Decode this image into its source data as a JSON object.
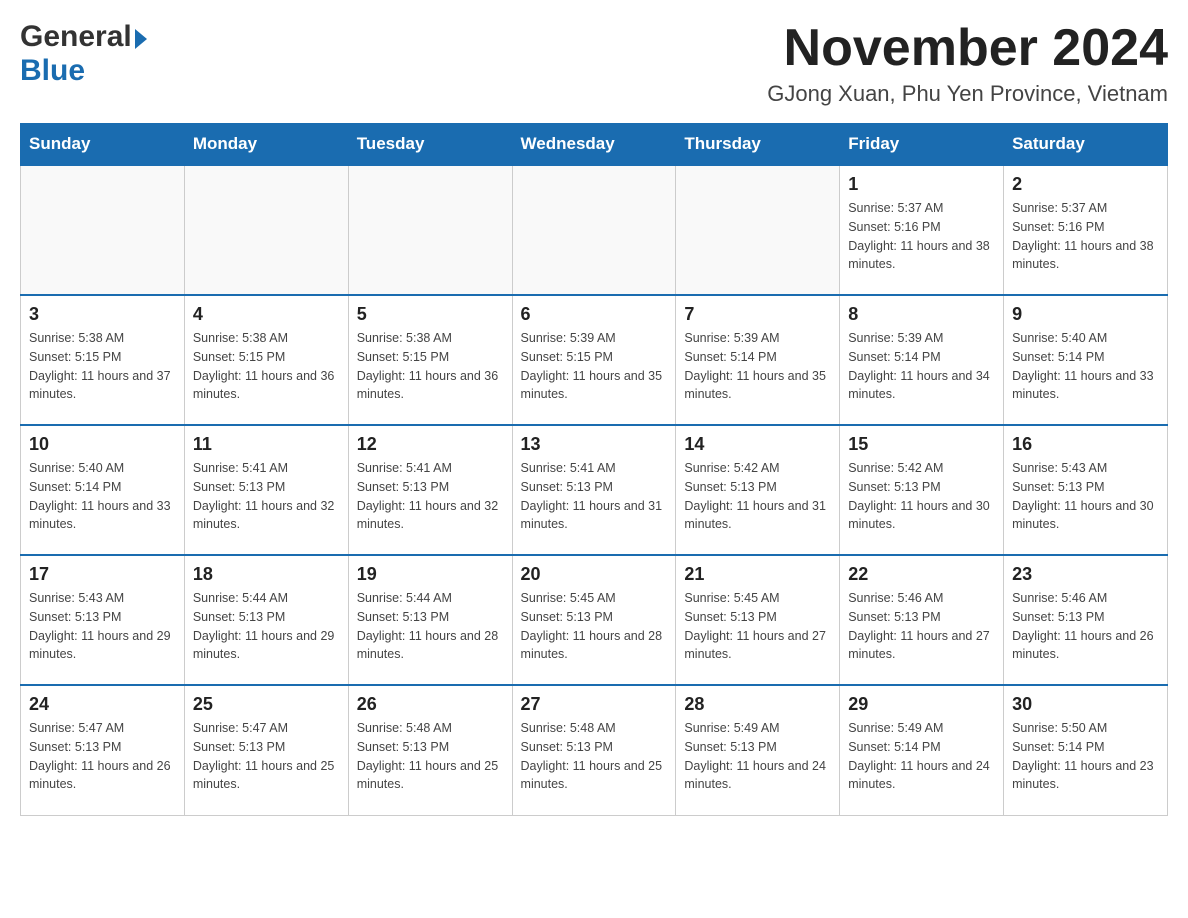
{
  "header": {
    "logo_general": "General",
    "logo_blue": "Blue",
    "month_title": "November 2024",
    "location": "GJong Xuan, Phu Yen Province, Vietnam"
  },
  "days_of_week": [
    "Sunday",
    "Monday",
    "Tuesday",
    "Wednesday",
    "Thursday",
    "Friday",
    "Saturday"
  ],
  "weeks": [
    [
      {
        "day": "",
        "info": ""
      },
      {
        "day": "",
        "info": ""
      },
      {
        "day": "",
        "info": ""
      },
      {
        "day": "",
        "info": ""
      },
      {
        "day": "",
        "info": ""
      },
      {
        "day": "1",
        "info": "Sunrise: 5:37 AM\nSunset: 5:16 PM\nDaylight: 11 hours and 38 minutes."
      },
      {
        "day": "2",
        "info": "Sunrise: 5:37 AM\nSunset: 5:16 PM\nDaylight: 11 hours and 38 minutes."
      }
    ],
    [
      {
        "day": "3",
        "info": "Sunrise: 5:38 AM\nSunset: 5:15 PM\nDaylight: 11 hours and 37 minutes."
      },
      {
        "day": "4",
        "info": "Sunrise: 5:38 AM\nSunset: 5:15 PM\nDaylight: 11 hours and 36 minutes."
      },
      {
        "day": "5",
        "info": "Sunrise: 5:38 AM\nSunset: 5:15 PM\nDaylight: 11 hours and 36 minutes."
      },
      {
        "day": "6",
        "info": "Sunrise: 5:39 AM\nSunset: 5:15 PM\nDaylight: 11 hours and 35 minutes."
      },
      {
        "day": "7",
        "info": "Sunrise: 5:39 AM\nSunset: 5:14 PM\nDaylight: 11 hours and 35 minutes."
      },
      {
        "day": "8",
        "info": "Sunrise: 5:39 AM\nSunset: 5:14 PM\nDaylight: 11 hours and 34 minutes."
      },
      {
        "day": "9",
        "info": "Sunrise: 5:40 AM\nSunset: 5:14 PM\nDaylight: 11 hours and 33 minutes."
      }
    ],
    [
      {
        "day": "10",
        "info": "Sunrise: 5:40 AM\nSunset: 5:14 PM\nDaylight: 11 hours and 33 minutes."
      },
      {
        "day": "11",
        "info": "Sunrise: 5:41 AM\nSunset: 5:13 PM\nDaylight: 11 hours and 32 minutes."
      },
      {
        "day": "12",
        "info": "Sunrise: 5:41 AM\nSunset: 5:13 PM\nDaylight: 11 hours and 32 minutes."
      },
      {
        "day": "13",
        "info": "Sunrise: 5:41 AM\nSunset: 5:13 PM\nDaylight: 11 hours and 31 minutes."
      },
      {
        "day": "14",
        "info": "Sunrise: 5:42 AM\nSunset: 5:13 PM\nDaylight: 11 hours and 31 minutes."
      },
      {
        "day": "15",
        "info": "Sunrise: 5:42 AM\nSunset: 5:13 PM\nDaylight: 11 hours and 30 minutes."
      },
      {
        "day": "16",
        "info": "Sunrise: 5:43 AM\nSunset: 5:13 PM\nDaylight: 11 hours and 30 minutes."
      }
    ],
    [
      {
        "day": "17",
        "info": "Sunrise: 5:43 AM\nSunset: 5:13 PM\nDaylight: 11 hours and 29 minutes."
      },
      {
        "day": "18",
        "info": "Sunrise: 5:44 AM\nSunset: 5:13 PM\nDaylight: 11 hours and 29 minutes."
      },
      {
        "day": "19",
        "info": "Sunrise: 5:44 AM\nSunset: 5:13 PM\nDaylight: 11 hours and 28 minutes."
      },
      {
        "day": "20",
        "info": "Sunrise: 5:45 AM\nSunset: 5:13 PM\nDaylight: 11 hours and 28 minutes."
      },
      {
        "day": "21",
        "info": "Sunrise: 5:45 AM\nSunset: 5:13 PM\nDaylight: 11 hours and 27 minutes."
      },
      {
        "day": "22",
        "info": "Sunrise: 5:46 AM\nSunset: 5:13 PM\nDaylight: 11 hours and 27 minutes."
      },
      {
        "day": "23",
        "info": "Sunrise: 5:46 AM\nSunset: 5:13 PM\nDaylight: 11 hours and 26 minutes."
      }
    ],
    [
      {
        "day": "24",
        "info": "Sunrise: 5:47 AM\nSunset: 5:13 PM\nDaylight: 11 hours and 26 minutes."
      },
      {
        "day": "25",
        "info": "Sunrise: 5:47 AM\nSunset: 5:13 PM\nDaylight: 11 hours and 25 minutes."
      },
      {
        "day": "26",
        "info": "Sunrise: 5:48 AM\nSunset: 5:13 PM\nDaylight: 11 hours and 25 minutes."
      },
      {
        "day": "27",
        "info": "Sunrise: 5:48 AM\nSunset: 5:13 PM\nDaylight: 11 hours and 25 minutes."
      },
      {
        "day": "28",
        "info": "Sunrise: 5:49 AM\nSunset: 5:13 PM\nDaylight: 11 hours and 24 minutes."
      },
      {
        "day": "29",
        "info": "Sunrise: 5:49 AM\nSunset: 5:14 PM\nDaylight: 11 hours and 24 minutes."
      },
      {
        "day": "30",
        "info": "Sunrise: 5:50 AM\nSunset: 5:14 PM\nDaylight: 11 hours and 23 minutes."
      }
    ]
  ]
}
